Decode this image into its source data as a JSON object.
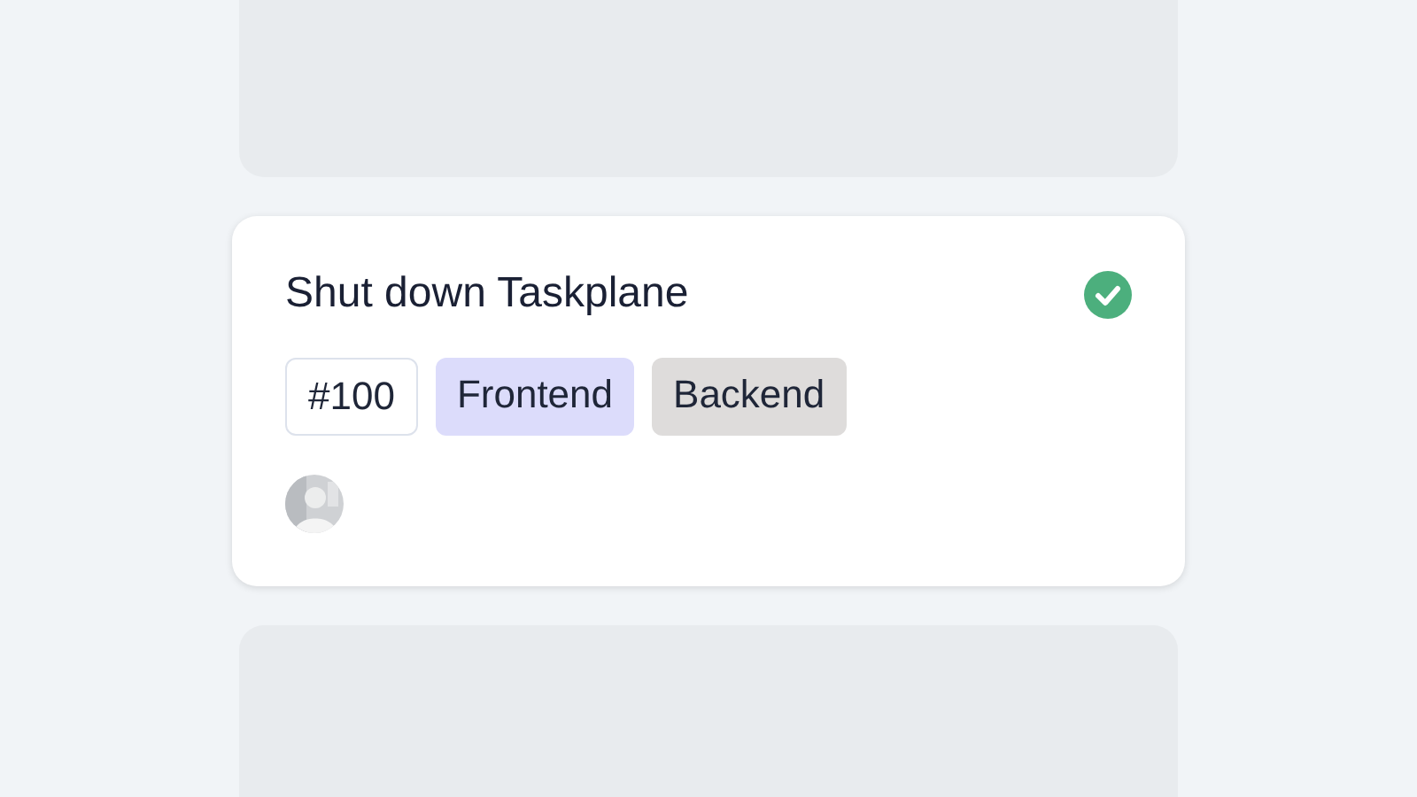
{
  "card": {
    "title": "Shut down Taskplane",
    "completed": true,
    "tags": [
      {
        "kind": "id",
        "label": "#100"
      },
      {
        "kind": "label",
        "label": "Frontend",
        "color": "#dcdcfb"
      },
      {
        "kind": "label",
        "label": "Backend",
        "color": "#dedcdb"
      }
    ]
  }
}
